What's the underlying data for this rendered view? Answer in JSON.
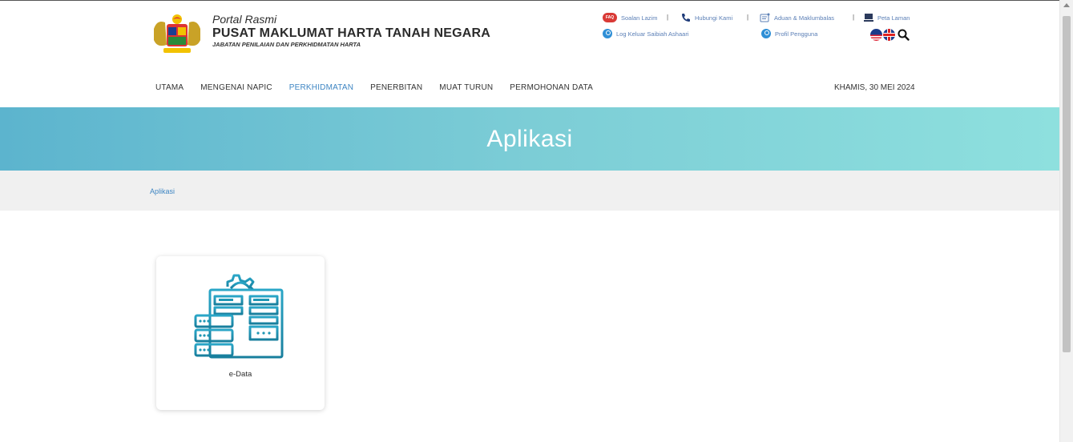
{
  "header": {
    "portal_label": "Portal Rasmi",
    "org_name": "PUSAT MAKLUMAT HARTA TANAH NEGARA",
    "org_sub": "JABATAN PENILAIAN DAN PERKHIDMATAN HARTA"
  },
  "utility": {
    "faq_badge": "FAQ",
    "faq": "Soalan Lazim",
    "contact": "Hubungi Kami",
    "feedback": "Aduan & Maklumbalas",
    "sitemap": "Peta Laman",
    "separator": "|",
    "logout": "Log Keluar Saibiah Ashaari",
    "profile": "Profil Pengguna"
  },
  "nav": {
    "items": [
      "UTAMA",
      "MENGENAI NAPIC",
      "PERKHIDMATAN",
      "PENERBITAN",
      "MUAT TURUN",
      "PERMOHONAN DATA"
    ],
    "active_index": 2,
    "date": "KHAMIS, 30 MEI 2024"
  },
  "banner": {
    "title": "Aplikasi"
  },
  "breadcrumb": {
    "current": "Aplikasi"
  },
  "apps": [
    {
      "label": "e-Data",
      "icon": "server-gear-icon"
    }
  ],
  "colors": {
    "accent_link": "#3f86c3",
    "banner_start": "#5cb4ce",
    "banner_end": "#8ee0de",
    "icon_teal": "#1f97b4"
  }
}
